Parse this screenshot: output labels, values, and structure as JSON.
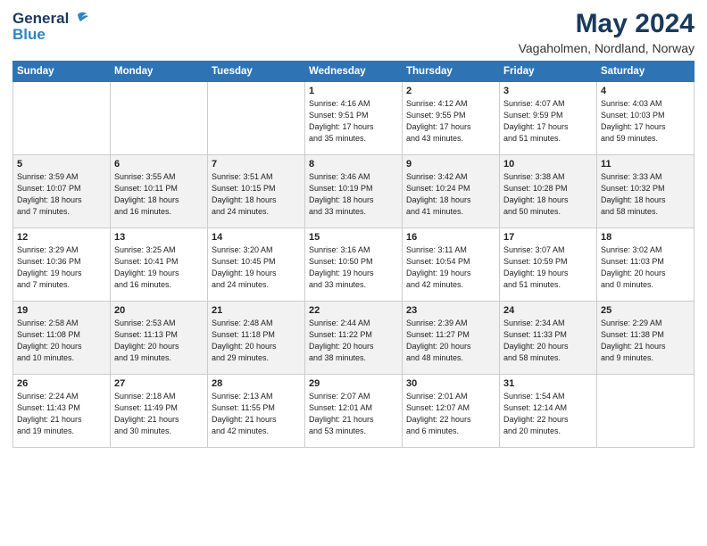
{
  "header": {
    "logo_general": "General",
    "logo_blue": "Blue",
    "month_title": "May 2024",
    "subtitle": "Vagaholmen, Nordland, Norway"
  },
  "weekdays": [
    "Sunday",
    "Monday",
    "Tuesday",
    "Wednesday",
    "Thursday",
    "Friday",
    "Saturday"
  ],
  "weeks": [
    [
      {
        "day": "",
        "text": ""
      },
      {
        "day": "",
        "text": ""
      },
      {
        "day": "",
        "text": ""
      },
      {
        "day": "1",
        "text": "Sunrise: 4:16 AM\nSunset: 9:51 PM\nDaylight: 17 hours\nand 35 minutes."
      },
      {
        "day": "2",
        "text": "Sunrise: 4:12 AM\nSunset: 9:55 PM\nDaylight: 17 hours\nand 43 minutes."
      },
      {
        "day": "3",
        "text": "Sunrise: 4:07 AM\nSunset: 9:59 PM\nDaylight: 17 hours\nand 51 minutes."
      },
      {
        "day": "4",
        "text": "Sunrise: 4:03 AM\nSunset: 10:03 PM\nDaylight: 17 hours\nand 59 minutes."
      }
    ],
    [
      {
        "day": "5",
        "text": "Sunrise: 3:59 AM\nSunset: 10:07 PM\nDaylight: 18 hours\nand 7 minutes."
      },
      {
        "day": "6",
        "text": "Sunrise: 3:55 AM\nSunset: 10:11 PM\nDaylight: 18 hours\nand 16 minutes."
      },
      {
        "day": "7",
        "text": "Sunrise: 3:51 AM\nSunset: 10:15 PM\nDaylight: 18 hours\nand 24 minutes."
      },
      {
        "day": "8",
        "text": "Sunrise: 3:46 AM\nSunset: 10:19 PM\nDaylight: 18 hours\nand 33 minutes."
      },
      {
        "day": "9",
        "text": "Sunrise: 3:42 AM\nSunset: 10:24 PM\nDaylight: 18 hours\nand 41 minutes."
      },
      {
        "day": "10",
        "text": "Sunrise: 3:38 AM\nSunset: 10:28 PM\nDaylight: 18 hours\nand 50 minutes."
      },
      {
        "day": "11",
        "text": "Sunrise: 3:33 AM\nSunset: 10:32 PM\nDaylight: 18 hours\nand 58 minutes."
      }
    ],
    [
      {
        "day": "12",
        "text": "Sunrise: 3:29 AM\nSunset: 10:36 PM\nDaylight: 19 hours\nand 7 minutes."
      },
      {
        "day": "13",
        "text": "Sunrise: 3:25 AM\nSunset: 10:41 PM\nDaylight: 19 hours\nand 16 minutes."
      },
      {
        "day": "14",
        "text": "Sunrise: 3:20 AM\nSunset: 10:45 PM\nDaylight: 19 hours\nand 24 minutes."
      },
      {
        "day": "15",
        "text": "Sunrise: 3:16 AM\nSunset: 10:50 PM\nDaylight: 19 hours\nand 33 minutes."
      },
      {
        "day": "16",
        "text": "Sunrise: 3:11 AM\nSunset: 10:54 PM\nDaylight: 19 hours\nand 42 minutes."
      },
      {
        "day": "17",
        "text": "Sunrise: 3:07 AM\nSunset: 10:59 PM\nDaylight: 19 hours\nand 51 minutes."
      },
      {
        "day": "18",
        "text": "Sunrise: 3:02 AM\nSunset: 11:03 PM\nDaylight: 20 hours\nand 0 minutes."
      }
    ],
    [
      {
        "day": "19",
        "text": "Sunrise: 2:58 AM\nSunset: 11:08 PM\nDaylight: 20 hours\nand 10 minutes."
      },
      {
        "day": "20",
        "text": "Sunrise: 2:53 AM\nSunset: 11:13 PM\nDaylight: 20 hours\nand 19 minutes."
      },
      {
        "day": "21",
        "text": "Sunrise: 2:48 AM\nSunset: 11:18 PM\nDaylight: 20 hours\nand 29 minutes."
      },
      {
        "day": "22",
        "text": "Sunrise: 2:44 AM\nSunset: 11:22 PM\nDaylight: 20 hours\nand 38 minutes."
      },
      {
        "day": "23",
        "text": "Sunrise: 2:39 AM\nSunset: 11:27 PM\nDaylight: 20 hours\nand 48 minutes."
      },
      {
        "day": "24",
        "text": "Sunrise: 2:34 AM\nSunset: 11:33 PM\nDaylight: 20 hours\nand 58 minutes."
      },
      {
        "day": "25",
        "text": "Sunrise: 2:29 AM\nSunset: 11:38 PM\nDaylight: 21 hours\nand 9 minutes."
      }
    ],
    [
      {
        "day": "26",
        "text": "Sunrise: 2:24 AM\nSunset: 11:43 PM\nDaylight: 21 hours\nand 19 minutes."
      },
      {
        "day": "27",
        "text": "Sunrise: 2:18 AM\nSunset: 11:49 PM\nDaylight: 21 hours\nand 30 minutes."
      },
      {
        "day": "28",
        "text": "Sunrise: 2:13 AM\nSunset: 11:55 PM\nDaylight: 21 hours\nand 42 minutes."
      },
      {
        "day": "29",
        "text": "Sunrise: 2:07 AM\nSunset: 12:01 AM\nDaylight: 21 hours\nand 53 minutes."
      },
      {
        "day": "30",
        "text": "Sunrise: 2:01 AM\nSunset: 12:07 AM\nDaylight: 22 hours\nand 6 minutes."
      },
      {
        "day": "31",
        "text": "Sunrise: 1:54 AM\nSunset: 12:14 AM\nDaylight: 22 hours\nand 20 minutes."
      },
      {
        "day": "",
        "text": ""
      }
    ]
  ]
}
